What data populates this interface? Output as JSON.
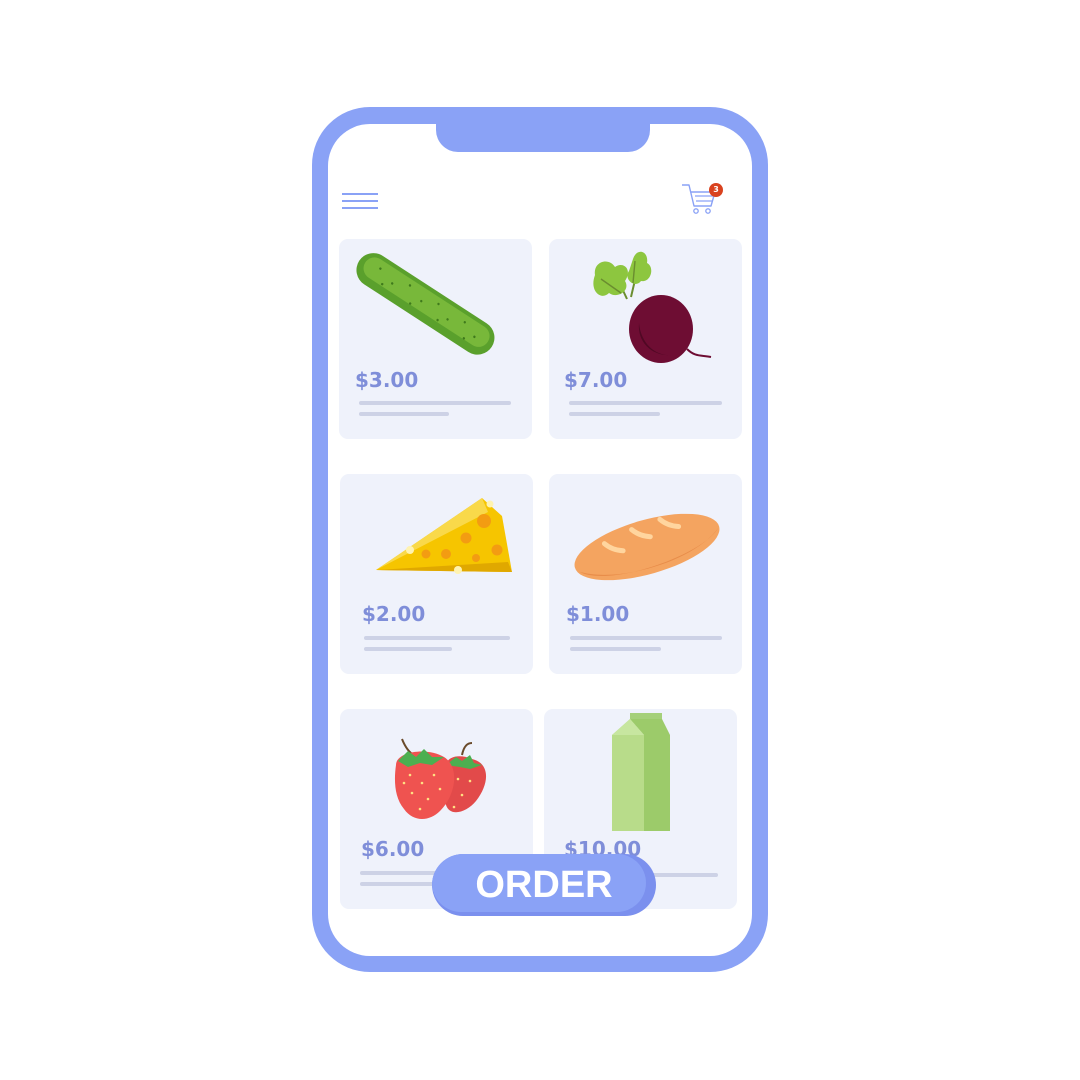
{
  "header": {
    "menu_icon": "hamburger-menu-icon",
    "cart_icon": "shopping-cart-icon",
    "cart_count": "3"
  },
  "products": [
    {
      "name": "cucumber",
      "icon": "cucumber-icon",
      "price": "$3.00"
    },
    {
      "name": "beetroot",
      "icon": "beetroot-icon",
      "price": "$7.00"
    },
    {
      "name": "cheese",
      "icon": "cheese-icon",
      "price": "$2.00"
    },
    {
      "name": "bread",
      "icon": "baguette-icon",
      "price": "$1.00"
    },
    {
      "name": "strawberries",
      "icon": "strawberry-icon",
      "price": "$6.00"
    },
    {
      "name": "milk",
      "icon": "milk-carton-icon",
      "price": "$10.00"
    }
  ],
  "order_button": {
    "label": "ORDER"
  },
  "colors": {
    "phone_frame": "#8aa2f6",
    "card_bg": "#eff2fb",
    "price_text": "#7f8ed9",
    "badge": "#d9421f"
  }
}
